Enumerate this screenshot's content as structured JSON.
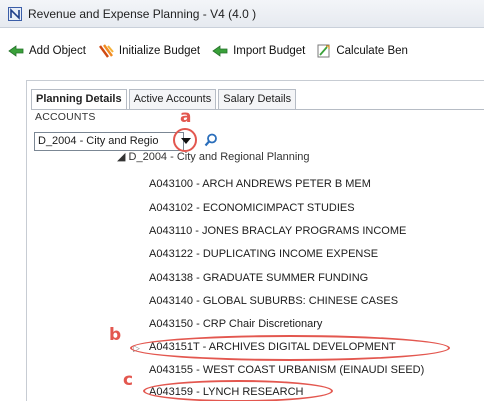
{
  "window": {
    "title": "Revenue and Expense Planning - V4 (4.0 )"
  },
  "toolbar": {
    "items": [
      {
        "label": "Add Object",
        "icon": "add-object-icon"
      },
      {
        "label": "Initialize Budget",
        "icon": "initialize-budget-icon"
      },
      {
        "label": "Import Budget",
        "icon": "import-budget-icon"
      },
      {
        "label": "Calculate Ben",
        "icon": "calculate-icon"
      }
    ]
  },
  "tabs": [
    {
      "label": "Planning Details",
      "active": true
    },
    {
      "label": "Active Accounts",
      "active": false
    },
    {
      "label": "Salary Details",
      "active": false
    }
  ],
  "accounts": {
    "label": "ACCOUNTS",
    "selected": "D_2004 - City and Regio"
  },
  "tree": {
    "root": "◢ D_2004 - City and Regional Planning",
    "items": [
      "A043100 - ARCH ANDREWS PETER B MEM",
      "A043102 - ECONOMICIMPACT STUDIES",
      "A043110 - JONES BRACLAY PROGRAMS INCOME",
      "A043122 - DUPLICATING INCOME EXPENSE",
      "A043138 - GRADUATE SUMMER FUNDING",
      "A043140 - GLOBAL SUBURBS: CHINESE CASES",
      "A043150 - CRP Chair Discretionary",
      "A043151T - ARCHIVES DIGITAL DEVELOPMENT",
      "A043155 - WEST COAST URBANISM (EINAUDI SEED)",
      "A043159 - LYNCH RESEARCH"
    ]
  },
  "annotations": {
    "a": "a",
    "b": "b",
    "c": "c"
  },
  "colors": {
    "annotation": "#e3574f",
    "accent": "#2a6ebb"
  }
}
